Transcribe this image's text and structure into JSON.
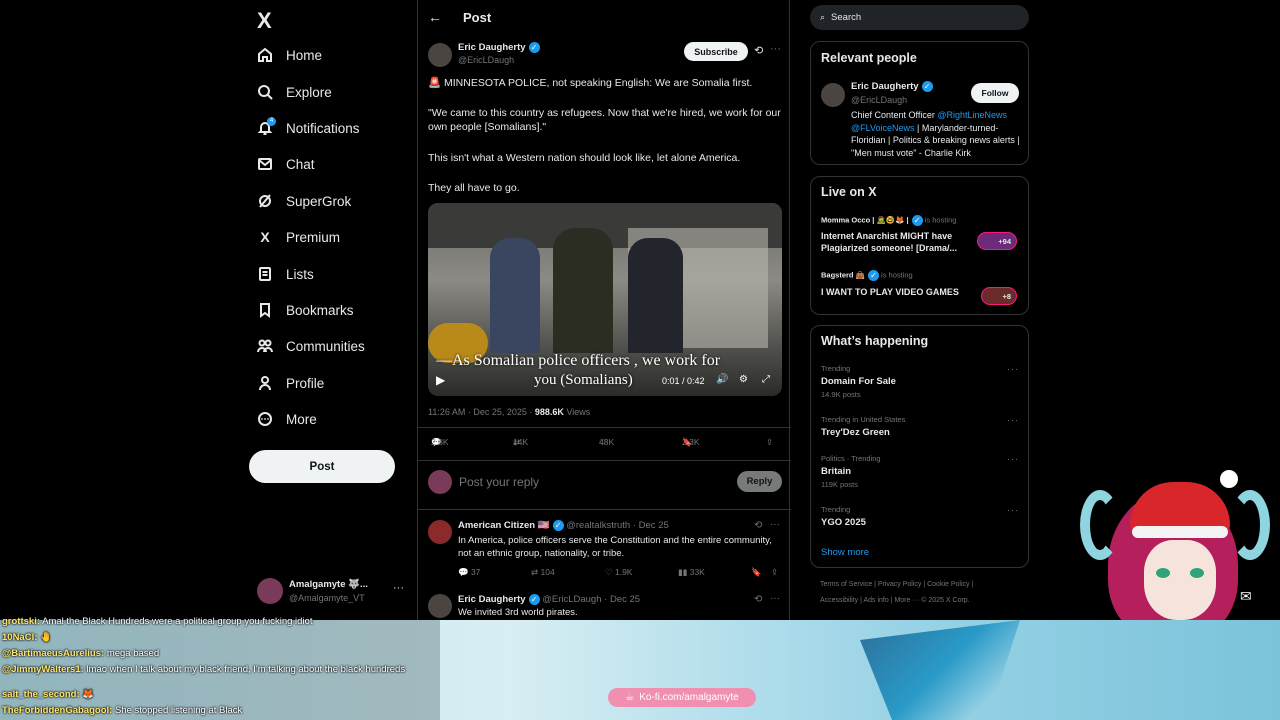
{
  "nav": {
    "logo": "X",
    "items": [
      {
        "label": "Home",
        "icon": "home-icon"
      },
      {
        "label": "Explore",
        "icon": "search-icon"
      },
      {
        "label": "Notifications",
        "icon": "bell-icon"
      },
      {
        "label": "Chat",
        "icon": "mail-icon"
      },
      {
        "label": "SuperGrok",
        "icon": "grok-icon"
      },
      {
        "label": "Premium",
        "icon": "x-icon"
      },
      {
        "label": "Lists",
        "icon": "list-icon"
      },
      {
        "label": "Bookmarks",
        "icon": "bookmark-icon"
      },
      {
        "label": "Communities",
        "icon": "people-icon"
      },
      {
        "label": "Profile",
        "icon": "person-icon"
      },
      {
        "label": "More",
        "icon": "more-circle-icon"
      }
    ],
    "notif_badge": "4",
    "post_button": "Post",
    "account": {
      "name": "Amalgamyte 🐺...",
      "handle": "@Amalgamyte_VT"
    }
  },
  "header": {
    "title": "Post"
  },
  "tweet": {
    "author_name": "Eric Daugherty",
    "author_handle": "@EricLDaugh",
    "subscribe": "Subscribe",
    "line1": "🚨 MINNESOTA POLICE, not speaking English: We are Somalia first.",
    "line2": "\"We came to this country as refugees. Now that we're hired, we work for our own people [Somalians].\"",
    "line3": "This isn't what a Western nation should look like, let alone America.",
    "line4": "They all have to go.",
    "video_caption_1": "As Somalian police officers , we work for",
    "video_caption_2": "you (Somalians)",
    "video_time": "0:01 / 0:42",
    "timestamp": "11:26 AM · Dec 25, 2025 · ",
    "views_count": "988.6K",
    "views_label": " Views",
    "replies": "2.8K",
    "reposts": "14K",
    "likes": "48K",
    "bookmarks": "2.3K"
  },
  "reply_box": {
    "placeholder": "Post your reply",
    "button": "Reply"
  },
  "replies": [
    {
      "name": "American Citizen 🇺🇸",
      "handle": "@realtalkstruth · Dec 25",
      "text": "In America, police officers serve the Constitution and the entire community, not an ethnic group, nationality, or tribe.",
      "reply_count": "37",
      "repost_count": "104",
      "like_count": "1.9K",
      "view_count": "33K"
    },
    {
      "name": "Eric Daugherty",
      "handle": "@EricLDaugh · Dec 25",
      "text": "We invited 3rd world pirates."
    }
  ],
  "right": {
    "search_placeholder": "Search",
    "relevant_title": "Relevant people",
    "person": {
      "name": "Eric Daugherty",
      "handle": "@EricLDaugh",
      "follow": "Follow",
      "bio_1": "Chief Content Officer ",
      "bio_link_1": "@RightLineNews",
      "bio_link_2": "@FLVoiceNews",
      "bio_2": " | Marylander-turned-Floridian | Politics & breaking news alerts | \"Men must vote\" - Charlie Kirk"
    },
    "live_title": "Live on X",
    "live": [
      {
        "host": "Momma Occo | 🧟🤓🦊 |",
        "status": "is hosting",
        "title": "Internet Anarchist MIGHT have Plagiarized someone! [Drama/...",
        "count": "+94"
      },
      {
        "host": "Bagsterd 👜",
        "status": "is hosting",
        "title": "I WANT TO PLAY VIDEO GAMES",
        "count": "+8"
      }
    ],
    "happening_title": "What’s happening",
    "trends": [
      {
        "category": "Trending",
        "name": "Domain For Sale",
        "count": "14.9K posts"
      },
      {
        "category": "Trending in United States",
        "name": "Trey'Dez Green",
        "count": ""
      },
      {
        "category": "Politics · Trending",
        "name": "Britain",
        "count": "119K posts"
      },
      {
        "category": "Trending",
        "name": "YGO 2025",
        "count": ""
      }
    ],
    "show_more": "Show more",
    "footer_1": "Terms of Service  |  Privacy Policy  |  Cookie Policy  |",
    "footer_2": "Accessibility  |  Ads info  |  More ···  © 2025 X Corp."
  },
  "stream": {
    "chat": [
      {
        "user": "grottski:",
        "msg": " Amal the Black Hundreds were a political group you fucking idiot"
      },
      {
        "user": "10NaCl:",
        "msg": " 🤚"
      },
      {
        "user": "@BartimaeusAurelius:",
        "msg": " mega based"
      },
      {
        "user": "@JimmyWalters1:",
        "msg": " lmao when I talk about my black friend, I'm talking about the black hundreds"
      },
      {
        "user": "salt_the_second:",
        "msg": " 🦊"
      },
      {
        "user": "TheForbiddenGabagool:",
        "msg": " She stopped listening at Black"
      }
    ],
    "kofi": "Ko-fi.com/amalgamyte"
  },
  "colors": {
    "accent": "#1d9bf0",
    "background": "#000000",
    "border": "#2f3336",
    "muted": "#71767b"
  }
}
